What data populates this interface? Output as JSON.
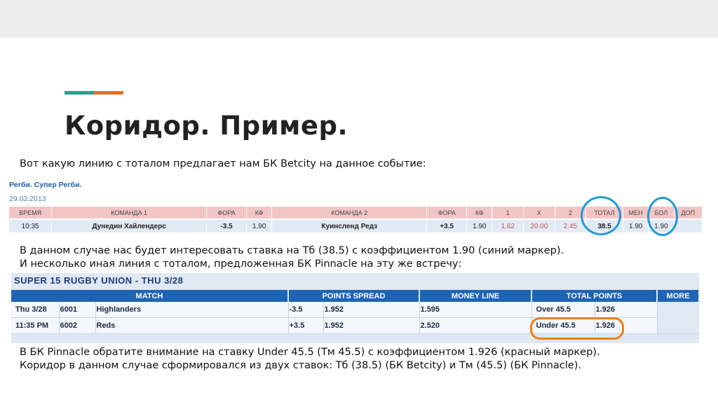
{
  "slide": {
    "title": "Коридор. Пример.",
    "intro": "Вот какую линию с тоталом предлагает нам БК Betcity на данное событие:",
    "mid_line1": "В данном случае нас будет интересовать ставка на Тб (38.5) с коэффициентом 1.90 (синий маркер).",
    "mid_line2": "И несколько иная линия с тоталом, предложенная БК Pinnacle на эту же встречу:",
    "bottom_line1": "В БК Pinnacle обратите внимание на ставку Under 45.5 (Тм 45.5) с коэффициентом 1.926 (красный маркер).",
    "bottom_line2": "Коридор в данном случае сформировался из двух ставок:  Тб (38.5) (БК Betcity) и Тм (45.5) (БК Pinnacle)."
  },
  "betcity": {
    "league": "Регби. Супер Регби.",
    "date": "29.03.2013",
    "headers": [
      "ВРЕМЯ",
      "КОМАНДА 1",
      "ФОРА",
      "КФ",
      "КОМАНДА 2",
      "ФОРА",
      "КФ",
      "1",
      "X",
      "2",
      "ТОТАЛ",
      "МЕН",
      "БОЛ",
      "ДОП"
    ],
    "row": [
      "10:35",
      "Дунедин Хайлендерс",
      "-3.5",
      "1.90",
      "Куинсленд Редз",
      "+3.5",
      "1.90",
      "1.62",
      "20.00",
      "2.45",
      "38.5",
      "1.90",
      "1.90",
      ""
    ]
  },
  "pinnacle": {
    "title": "SUPER 15 RUGBY UNION - THU 3/28",
    "headers": [
      "MATCH",
      "POINTS SPREAD",
      "MONEY LINE",
      "TOTAL POINTS",
      "MORE"
    ],
    "rows": [
      {
        "date": "Thu 3/28",
        "num": "6001",
        "team": "Highlanders",
        "spread": "-3.5",
        "spread_odds": "1.952",
        "money": "1.595",
        "total": "Over 45.5",
        "total_odds": "1.926"
      },
      {
        "date": "11:35 PM",
        "num": "6002",
        "team": "Reds",
        "spread": "+3.5",
        "spread_odds": "1.952",
        "money": "2.520",
        "total": "Under 45.5",
        "total_odds": "1.926"
      }
    ]
  },
  "colors": {
    "accent_teal": "#2a9d8f",
    "accent_orange": "#e76f1f",
    "blue_marker": "#1f9ad6",
    "red_marker": "#ef7f1a"
  }
}
